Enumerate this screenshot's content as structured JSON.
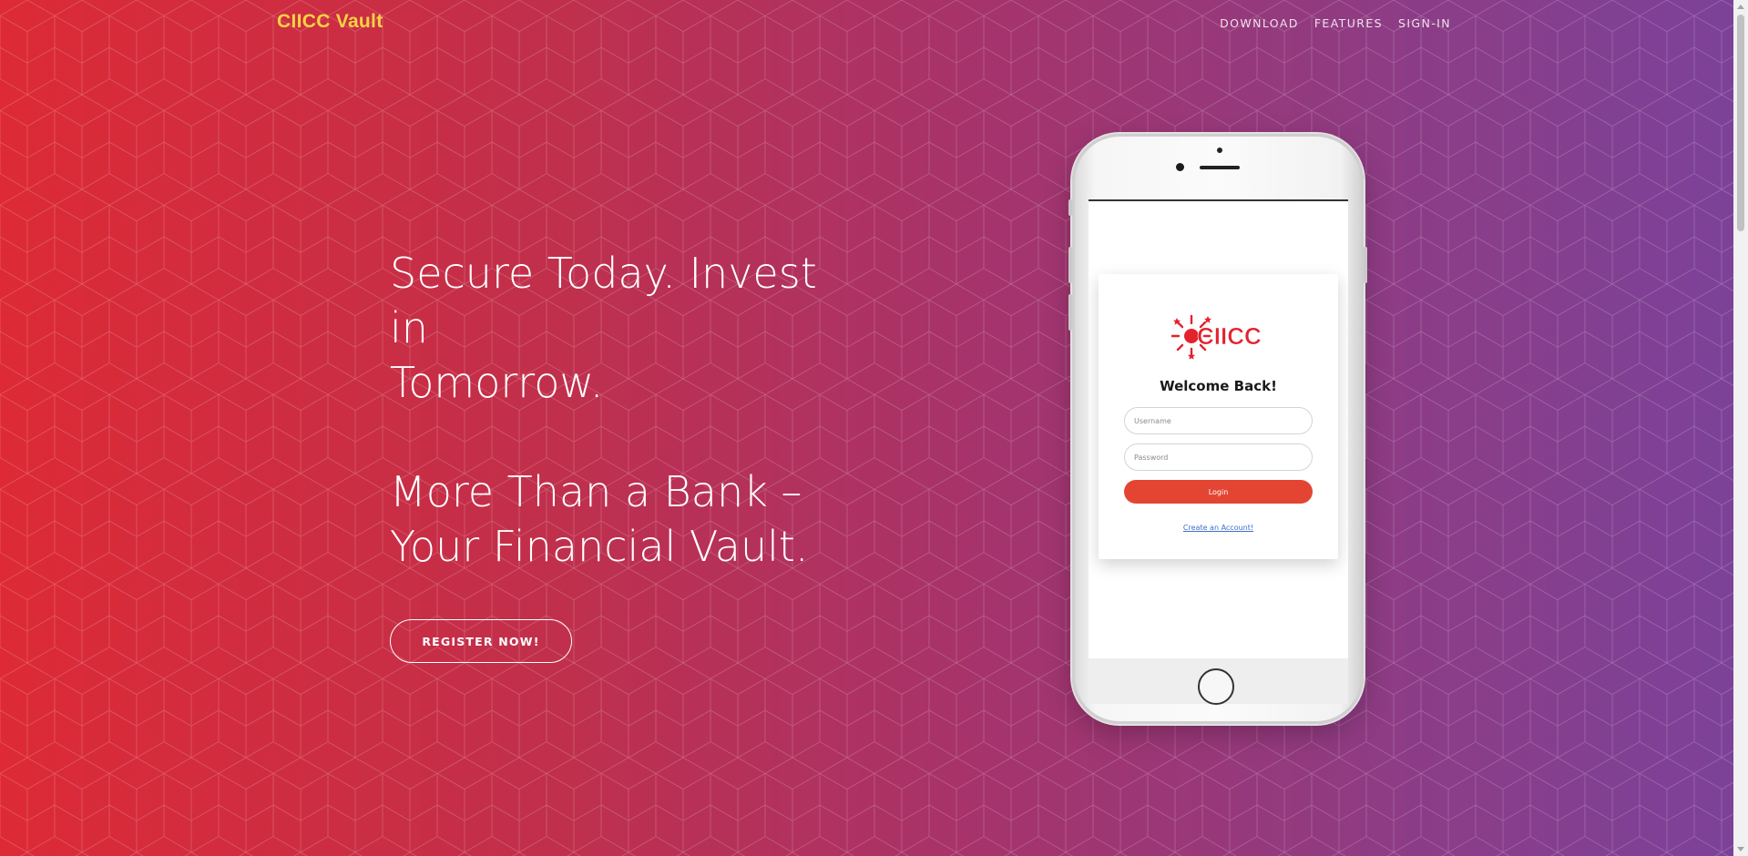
{
  "navbar": {
    "brand": "CIICC Vault",
    "links": [
      "DOWNLOAD",
      "FEATURES",
      "SIGN-IN"
    ]
  },
  "hero": {
    "headline_line1": "Secure Today. Invest in",
    "headline_line2": "Tomorrow.",
    "subheadline_line1": "More Than a Bank –",
    "subheadline_line2": "Your Financial Vault.",
    "cta_label": "REGISTER NOW!"
  },
  "phone_screen": {
    "logo_text": "CIICC",
    "welcome": "Welcome Back!",
    "username_placeholder": "Username",
    "password_placeholder": "Password",
    "login_label": "Login",
    "create_account_link": "Create an Account!"
  },
  "colors": {
    "brand": "#f5d342",
    "gradient_start": "#dd2a36",
    "gradient_end": "#7b429a",
    "login_button": "#e44533",
    "logo_red": "#e4222e"
  }
}
